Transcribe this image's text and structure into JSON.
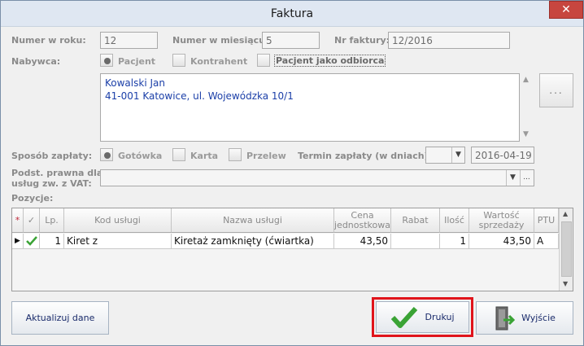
{
  "window": {
    "title": "Faktura",
    "close_glyph": "✕"
  },
  "labels": {
    "numer_w_roku": "Numer w roku:",
    "numer_w_miesiacu": "Numer w miesiącu:",
    "nr_faktury": "Nr faktury:",
    "nabywca": "Nabywca:",
    "sposob_zaplaty": "Sposób zapłaty:",
    "termin_zaplaty": "Termin zapłaty (w dniach):",
    "podst_prawna_1": "Podst. prawna dla",
    "podst_prawna_2": "usług zw. z VAT:",
    "pozycje": "Pozycje:"
  },
  "fields": {
    "numer_w_roku": "12",
    "numer_w_miesiacu": "5",
    "nr_faktury": "12/2016",
    "termin_dni": "",
    "termin_data": "2016-04-19",
    "podst_prawna": ""
  },
  "nabywca_options": {
    "pacjent": "Pacjent",
    "kontrahent": "Kontrahent",
    "pacjent_odbiorca": "Pacjent jako odbiorca"
  },
  "address": {
    "line1": "Kowalski Jan",
    "line2": "41-001 Katowice, ul. Wojewódzka 10/1"
  },
  "dots_label": "...",
  "payment_options": {
    "gotowka": "Gotówka",
    "karta": "Karta",
    "przelew": "Przelew"
  },
  "ellipsis": "...",
  "table": {
    "headers": {
      "star": "*",
      "check": "✓",
      "lp": "Lp.",
      "kod": "Kod usługi",
      "nazwa": "Nazwa usługi",
      "cena_1": "Cena",
      "cena_2": "jednostkowa",
      "rabat": "Rabat",
      "ilosc": "Ilość",
      "wartosc_1": "Wartość",
      "wartosc_2": "sprzedaży",
      "ptu": "PTU"
    },
    "rows": [
      {
        "lp": "1",
        "kod": "Kiret z",
        "nazwa": "Kiretaż zamknięty (ćwiartka)",
        "cena": "43,50",
        "rabat": "",
        "ilosc": "1",
        "wartosc": "43,50",
        "ptu": "A"
      }
    ]
  },
  "buttons": {
    "aktualizuj": "Aktualizuj dane",
    "drukuj": "Drukuj",
    "wyjscie": "Wyjście"
  },
  "icons": {
    "check_icon": "checkmark",
    "exit_icon": "door-exit",
    "row_pointer": "triangle-right"
  },
  "colors": {
    "highlight": "#e0141b",
    "address_text": "#1b3fa8",
    "check_green": "#3aa335"
  }
}
